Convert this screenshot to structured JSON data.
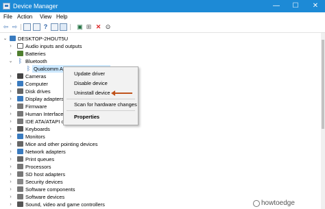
{
  "window": {
    "title": "Device Manager",
    "controls": {
      "minimize": "—",
      "maximize": "☐",
      "close": "✕"
    }
  },
  "menu": [
    "File",
    "Action",
    "View",
    "Help"
  ],
  "toolbar": {
    "buttons": [
      "back-arrow-icon",
      "forward-arrow-icon",
      "properties-icon",
      "help-icon",
      "update-driver-icon",
      "scan-hardware-icon",
      "uninstall-icon",
      "download-icon"
    ]
  },
  "tree": {
    "root": "DESKTOP-2HOUT5U",
    "items": [
      {
        "label": "Audio inputs and outputs",
        "icon": "audio-icon",
        "color": "#555555"
      },
      {
        "label": "Batteries",
        "icon": "battery-icon",
        "color": "#4f7f2f"
      },
      {
        "label": "Bluetooth",
        "icon": "bluetooth-icon",
        "color": "#2b6cb8",
        "expanded": true
      },
      {
        "label": "Qualcomm Atheros Bluetooth 4.0",
        "icon": "bluetooth-icon",
        "color": "#2b6cb8",
        "child": true,
        "selected": true
      },
      {
        "label": "Cameras",
        "icon": "camera-icon",
        "color": "#444444"
      },
      {
        "label": "Computer",
        "icon": "computer-icon",
        "color": "#3a7bbf"
      },
      {
        "label": "Disk drives",
        "icon": "disk-icon",
        "color": "#666666"
      },
      {
        "label": "Display adapters",
        "icon": "display-icon",
        "color": "#3a7bbf"
      },
      {
        "label": "Firmware",
        "icon": "firmware-icon",
        "color": "#777777"
      },
      {
        "label": "Human Interface Devices",
        "icon": "hid-icon",
        "color": "#777777"
      },
      {
        "label": "IDE ATA/ATAPI controllers",
        "icon": "ide-icon",
        "color": "#777777"
      },
      {
        "label": "Keyboards",
        "icon": "keyboard-icon",
        "color": "#555555"
      },
      {
        "label": "Monitors",
        "icon": "monitor-icon",
        "color": "#3a7bbf"
      },
      {
        "label": "Mice and other pointing devices",
        "icon": "mouse-icon",
        "color": "#666666"
      },
      {
        "label": "Network adapters",
        "icon": "network-icon",
        "color": "#3a7bbf"
      },
      {
        "label": "Print queues",
        "icon": "printer-icon",
        "color": "#666666"
      },
      {
        "label": "Processors",
        "icon": "processor-icon",
        "color": "#777777"
      },
      {
        "label": "SD host adapters",
        "icon": "sd-icon",
        "color": "#777777"
      },
      {
        "label": "Security devices",
        "icon": "security-icon",
        "color": "#888888"
      },
      {
        "label": "Software components",
        "icon": "component-icon",
        "color": "#777777"
      },
      {
        "label": "Software devices",
        "icon": "software-icon",
        "color": "#777777"
      },
      {
        "label": "Sound, video and game controllers",
        "icon": "sound-icon",
        "color": "#555555"
      }
    ]
  },
  "context_menu": {
    "items": [
      "Update driver",
      "Disable device",
      "Uninstall device",
      "Scan for hardware changes",
      "Properties"
    ]
  },
  "annotation": {
    "arrow_color": "#c0531c"
  },
  "watermark": "howtoedge"
}
